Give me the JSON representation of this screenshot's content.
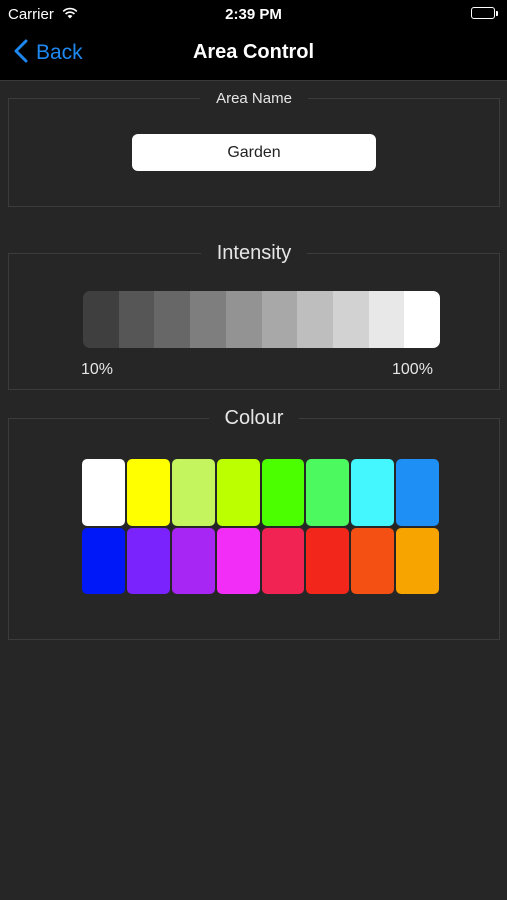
{
  "status_bar": {
    "carrier": "Carrier",
    "time": "2:39 PM"
  },
  "nav": {
    "back_label": "Back",
    "title": "Area Control"
  },
  "area_name": {
    "legend": "Area Name",
    "value": "Garden"
  },
  "intensity": {
    "legend": "Intensity",
    "min_label": "10%",
    "max_label": "100%",
    "steps": [
      "#3f3f3f",
      "#565656",
      "#676767",
      "#7e7e7e",
      "#939393",
      "#a8a8a8",
      "#bebebe",
      "#d2d2d2",
      "#e8e8e8",
      "#ffffff"
    ]
  },
  "colour": {
    "legend": "Colour",
    "swatches": [
      "#ffffff",
      "#ffff00",
      "#c5f55e",
      "#bcff00",
      "#4cff00",
      "#4cf95e",
      "#44f6fe",
      "#1e8ff5",
      "#0018f8",
      "#7a23fd",
      "#a826f3",
      "#f22df8",
      "#f12352",
      "#f2261b",
      "#f55014",
      "#f7a300"
    ]
  }
}
